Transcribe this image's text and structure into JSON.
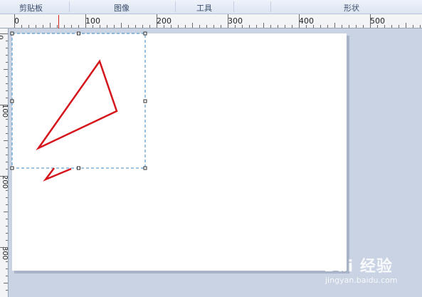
{
  "ribbon": {
    "tabs": [
      {
        "label": "剪贴板"
      },
      {
        "label": "图像"
      },
      {
        "label": "工具"
      },
      {
        "label": "形状"
      }
    ]
  },
  "ruler": {
    "top_labels": [
      "0",
      "100",
      "200",
      "300",
      "400",
      "500"
    ],
    "left_labels": [
      "0",
      "100",
      "200",
      "300"
    ]
  },
  "colors": {
    "stroke": "#d6141c",
    "selection": "#3b8ac4"
  },
  "watermark": {
    "brand": "Bai 经验",
    "url": "jingyan.baidu.com"
  }
}
